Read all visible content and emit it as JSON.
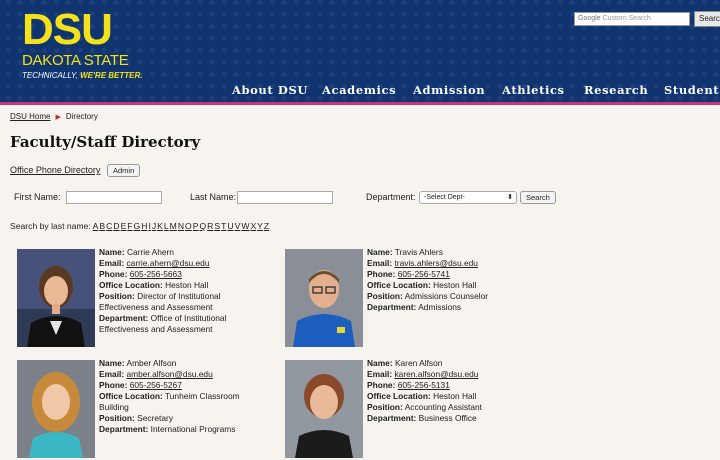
{
  "logo": {
    "dsu": "DSU",
    "name": "DAKOTA STATE",
    "tagline_a": "TECHNICALLY,",
    "tagline_b": "WE'RE BETTER."
  },
  "site_search": {
    "placeholder": "Custom Search",
    "brand": "Google",
    "button": "Search"
  },
  "nav": [
    "About DSU",
    "Academics",
    "Admission",
    "Athletics",
    "Research",
    "Student L"
  ],
  "breadcrumb": {
    "home": "DSU Home",
    "current": "Directory"
  },
  "page_title": "Faculty/Staff Directory",
  "office_link": "Office Phone Directory",
  "admin_button": "Admin",
  "form": {
    "first_name_label": "First Name:",
    "last_name_label": "Last Name:",
    "department_label": "Department:",
    "department_selected": "-Select Dept-",
    "search_button": "Search"
  },
  "alpha": {
    "label": "Search by last name:",
    "letters": [
      "A",
      "B",
      "C",
      "D",
      "E",
      "F",
      "G",
      "H",
      "I",
      "J",
      "K",
      "L",
      "M",
      "N",
      "O",
      "P",
      "Q",
      "R",
      "S",
      "T",
      "U",
      "V",
      "W",
      "X",
      "Y",
      "Z"
    ]
  },
  "field_labels": {
    "name": "Name",
    "email": "Email",
    "phone": "Phone",
    "office": "Office Location",
    "position": "Position",
    "department": "Department"
  },
  "people": [
    {
      "name": "Carrie Ahern",
      "email": "carrie.ahern@dsu.edu",
      "phone": "605-256-5663",
      "office": "Heston Hall",
      "position": "Director of Institutional Effectiveness and Assessment",
      "department": "Office of Institutional Effectiveness and Assessment"
    },
    {
      "name": "Travis Ahlers",
      "email": "travis.ahlers@dsu.edu",
      "phone": "605-256-5741",
      "office": "Heston Hall",
      "position": "Admissions Counselor",
      "department": "Admissions"
    },
    {
      "name": "Amber Alfson",
      "email": "amber.alfson@dsu.edu",
      "phone": "605-256-5267",
      "office": "Tunheim Classroom Building",
      "position": "Secretary",
      "department": "International Programs"
    },
    {
      "name": "Karen Alfson",
      "email": "karen.alfson@dsu.edu",
      "phone": "605-256-5131",
      "office": "Heston Hall",
      "position": "Accounting Assistant",
      "department": "Business Office"
    }
  ]
}
